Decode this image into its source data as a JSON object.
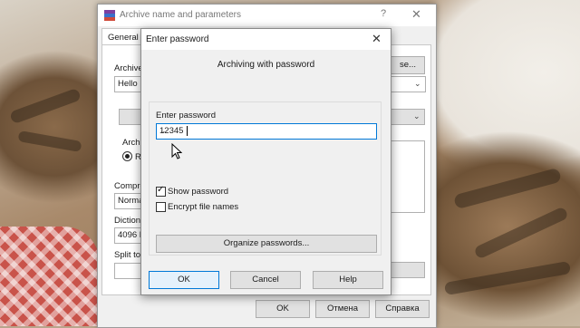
{
  "main_window": {
    "title": "Archive name and parameters",
    "help": "?",
    "close": "✕",
    "tab_general": "General",
    "archive_label": "Archive",
    "archive_value": "Hello",
    "browse_tail": "se...",
    "archive_format_label": "Archiv",
    "format_rar": "RA",
    "compression_label": "Compre",
    "compression_value": "Norma",
    "dictionary_label": "Diction",
    "dictionary_value": "4096 K",
    "split_label": "Split to",
    "ok": "OK",
    "cancel": "Отмена",
    "help_button": "Справка"
  },
  "dialog": {
    "title": "Enter password",
    "close": "✕",
    "heading": "Archiving with password",
    "password_label": "Enter password",
    "password_value": "12345",
    "show_password": "Show password",
    "show_password_checked": true,
    "encrypt_file_names": "Encrypt file names",
    "encrypt_file_names_checked": false,
    "organize": "Organize passwords...",
    "ok": "OK",
    "cancel": "Cancel",
    "help": "Help"
  },
  "icons": {
    "app": "winrar-icon",
    "cursor": "mouse-pointer-icon"
  }
}
